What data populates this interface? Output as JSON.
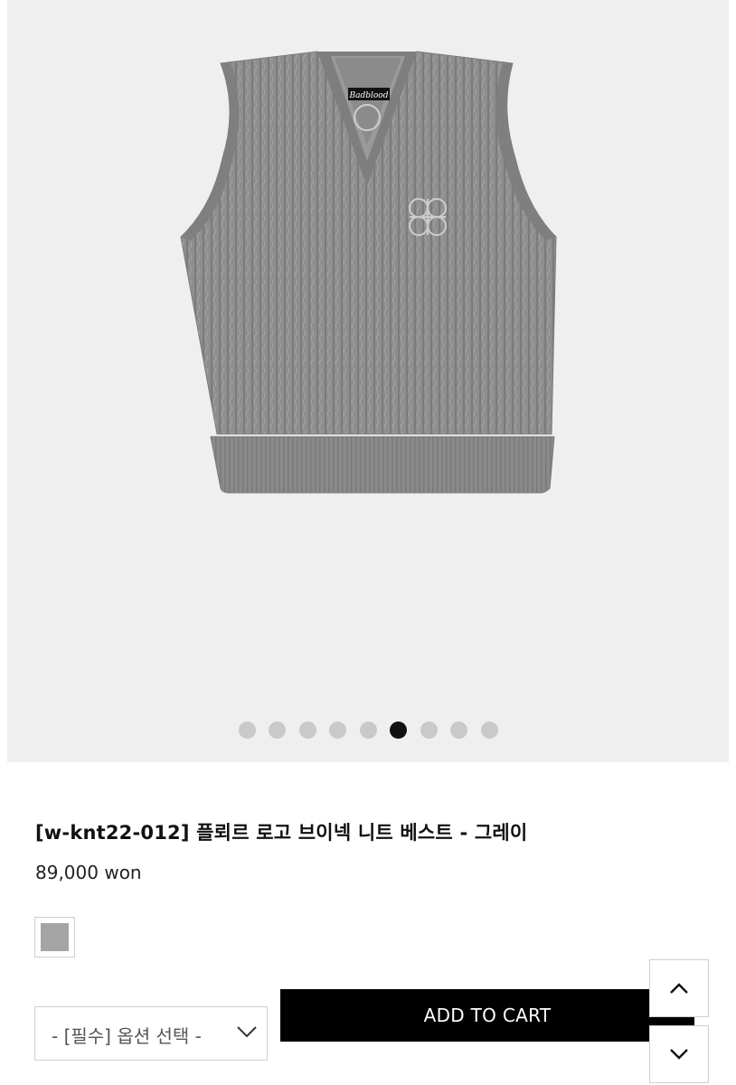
{
  "product": {
    "title": "[w-knt22-012] 플뢰르 로고 브이넥 니트 베스트 - 그레이",
    "price": "89,000 won",
    "image": {
      "label_text": "Badblood",
      "icon": "knit-vest-image",
      "color": "#8e8e8e"
    }
  },
  "gallery": {
    "total_slides": 9,
    "active_index": 5
  },
  "options": {
    "swatch": {
      "color": "#a4a4a4",
      "icon": "gray-color-swatch"
    },
    "select": {
      "label": "- [필수] 옵션 선택 -",
      "icon": "chevron-down-icon"
    }
  },
  "actions": {
    "add_to_cart": "ADD TO CART"
  },
  "scroll": {
    "up_icon": "chevron-up-icon",
    "down_icon": "chevron-down-icon"
  }
}
